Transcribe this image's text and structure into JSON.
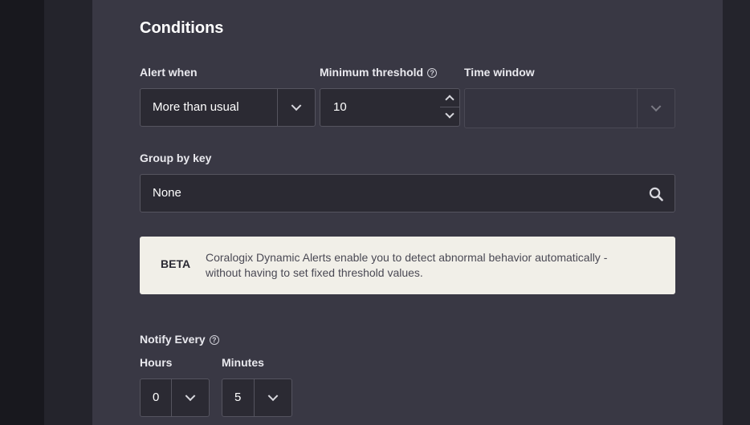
{
  "conditions": {
    "title": "Conditions",
    "alert_when": {
      "label": "Alert when",
      "value": "More than usual"
    },
    "minimum_threshold": {
      "label": "Minimum threshold",
      "value": "10",
      "help_icon": "question-circle-icon"
    },
    "time_window": {
      "label": "Time window",
      "placeholder": ""
    },
    "group_by_key": {
      "label": "Group by key",
      "value": "None",
      "icon": "search-icon"
    }
  },
  "beta_notice": {
    "tag": "BETA",
    "text": "Coralogix Dynamic Alerts enable you to detect abnormal behavior automatically - without having to set fixed threshold values."
  },
  "notify_every": {
    "label": "Notify Every",
    "help_icon": "question-circle-icon",
    "hours": {
      "label": "Hours",
      "value": "0"
    },
    "minutes": {
      "label": "Minutes",
      "value": "5"
    }
  },
  "colors": {
    "panel_bg": "#393844",
    "field_bg": "#2b2a33",
    "notice_bg": "#f1efe8",
    "text": "#ffffff"
  }
}
